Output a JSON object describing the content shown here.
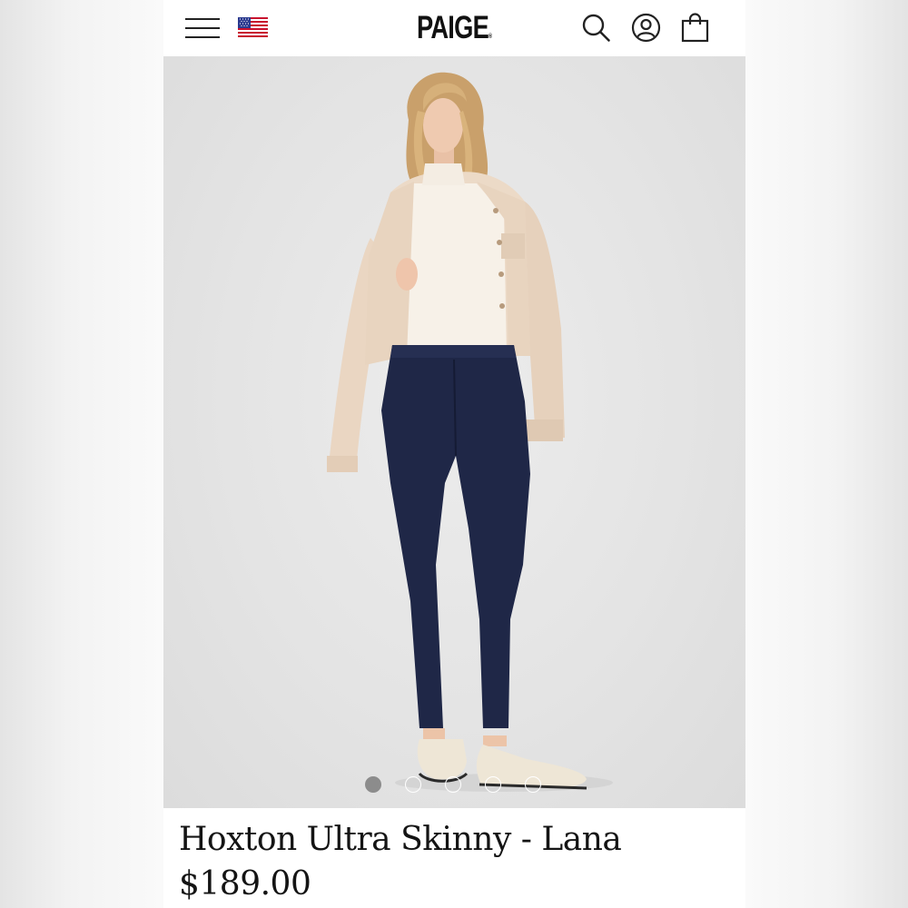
{
  "header": {
    "logo": "PAIGE",
    "logo_mark": "®",
    "icons": [
      "hamburger-menu-icon",
      "us-flag-icon",
      "search-icon",
      "account-icon",
      "shopping-bag-icon"
    ]
  },
  "gallery": {
    "image_count": 5,
    "active_index": 0,
    "colors": {
      "background": "#e4e4e4",
      "active_dot": "#8c8c8c",
      "inactive_dot": "#ffffff"
    }
  },
  "product": {
    "title": "Hoxton Ultra Skinny - Lana",
    "price": "$189.00"
  }
}
